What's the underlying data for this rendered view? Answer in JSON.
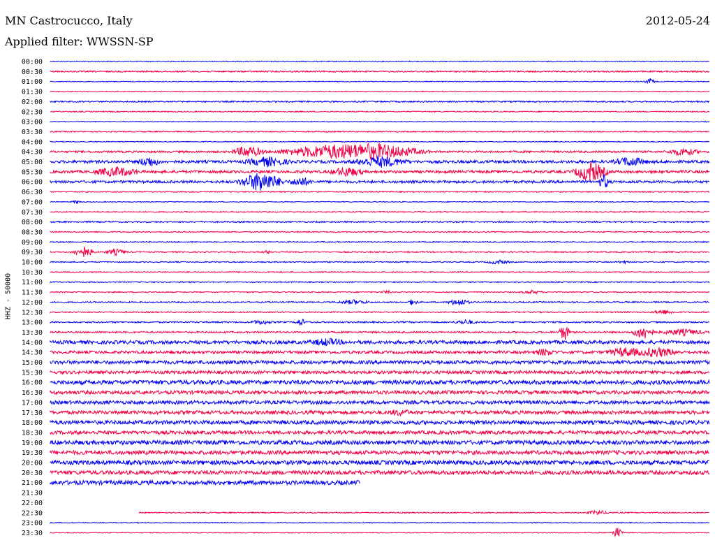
{
  "header": {
    "station": "MN Castrocucco, Italy",
    "date": "2012-05-24",
    "filter": "Applied filter: WWSSN-SP"
  },
  "chart_data": {
    "type": "line",
    "title": "MN Castrocucco, Italy",
    "ylabel": "HHZ - 50000",
    "trace_colors": [
      "#0000ee",
      "#ee0044"
    ],
    "rows": [
      {
        "label": "00:00",
        "coverage": 1.0,
        "noise": 0.6,
        "events": []
      },
      {
        "label": "00:30",
        "coverage": 1.0,
        "noise": 1.0,
        "events": []
      },
      {
        "label": "01:00",
        "coverage": 1.0,
        "noise": 0.6,
        "events": [
          {
            "at": 0.91,
            "amp": 4,
            "width": 0.01
          }
        ]
      },
      {
        "label": "01:30",
        "coverage": 1.0,
        "noise": 0.6,
        "events": []
      },
      {
        "label": "02:00",
        "coverage": 1.0,
        "noise": 1.0,
        "events": []
      },
      {
        "label": "02:30",
        "coverage": 1.0,
        "noise": 0.8,
        "events": []
      },
      {
        "label": "03:00",
        "coverage": 1.0,
        "noise": 0.6,
        "events": []
      },
      {
        "label": "03:30",
        "coverage": 1.0,
        "noise": 0.8,
        "events": []
      },
      {
        "label": "04:00",
        "coverage": 1.0,
        "noise": 0.6,
        "events": []
      },
      {
        "label": "04:30",
        "coverage": 1.0,
        "noise": 1.4,
        "events": [
          {
            "at": 0.3,
            "amp": 8,
            "width": 0.03
          },
          {
            "at": 0.42,
            "amp": 9,
            "width": 0.09
          },
          {
            "at": 0.5,
            "amp": 10,
            "width": 0.08
          },
          {
            "at": 0.96,
            "amp": 5,
            "width": 0.03
          }
        ]
      },
      {
        "label": "05:00",
        "coverage": 1.0,
        "noise": 2.0,
        "events": [
          {
            "at": 0.15,
            "amp": 7,
            "width": 0.02
          },
          {
            "at": 0.33,
            "amp": 6,
            "width": 0.04
          },
          {
            "at": 0.5,
            "amp": 7,
            "width": 0.05
          },
          {
            "at": 0.88,
            "amp": 6,
            "width": 0.03
          }
        ]
      },
      {
        "label": "05:30",
        "coverage": 1.0,
        "noise": 2.0,
        "events": [
          {
            "at": 0.1,
            "amp": 6,
            "width": 0.04
          },
          {
            "at": 0.45,
            "amp": 6,
            "width": 0.03
          },
          {
            "at": 0.82,
            "amp": 14,
            "width": 0.03
          }
        ]
      },
      {
        "label": "06:00",
        "coverage": 1.0,
        "noise": 1.8,
        "events": [
          {
            "at": 0.32,
            "amp": 14,
            "width": 0.04
          },
          {
            "at": 0.38,
            "amp": 6,
            "width": 0.02
          },
          {
            "at": 0.84,
            "amp": 10,
            "width": 0.01
          }
        ]
      },
      {
        "label": "06:30",
        "coverage": 1.0,
        "noise": 0.8,
        "events": []
      },
      {
        "label": "07:00",
        "coverage": 1.0,
        "noise": 0.6,
        "events": [
          {
            "at": 0.04,
            "amp": 2,
            "width": 0.01
          }
        ]
      },
      {
        "label": "07:30",
        "coverage": 1.0,
        "noise": 0.8,
        "events": []
      },
      {
        "label": "08:00",
        "coverage": 1.0,
        "noise": 1.0,
        "events": []
      },
      {
        "label": "08:30",
        "coverage": 1.0,
        "noise": 0.8,
        "events": []
      },
      {
        "label": "09:00",
        "coverage": 1.0,
        "noise": 0.8,
        "events": []
      },
      {
        "label": "09:30",
        "coverage": 1.0,
        "noise": 0.9,
        "events": [
          {
            "at": 0.05,
            "amp": 8,
            "width": 0.02
          },
          {
            "at": 0.1,
            "amp": 4,
            "width": 0.02
          },
          {
            "at": 0.33,
            "amp": 2,
            "width": 0.01
          }
        ]
      },
      {
        "label": "10:00",
        "coverage": 1.0,
        "noise": 0.8,
        "events": [
          {
            "at": 0.68,
            "amp": 3,
            "width": 0.02
          },
          {
            "at": 0.87,
            "amp": 2,
            "width": 0.01
          }
        ]
      },
      {
        "label": "10:30",
        "coverage": 1.0,
        "noise": 0.8,
        "events": []
      },
      {
        "label": "11:00",
        "coverage": 1.0,
        "noise": 0.8,
        "events": []
      },
      {
        "label": "11:30",
        "coverage": 1.0,
        "noise": 0.8,
        "events": [
          {
            "at": 0.51,
            "amp": 2,
            "width": 0.01
          },
          {
            "at": 0.73,
            "amp": 2,
            "width": 0.02
          }
        ]
      },
      {
        "label": "12:00",
        "coverage": 1.0,
        "noise": 0.9,
        "events": [
          {
            "at": 0.46,
            "amp": 3,
            "width": 0.03
          },
          {
            "at": 0.55,
            "amp": 4,
            "width": 0.01
          },
          {
            "at": 0.62,
            "amp": 5,
            "width": 0.02
          }
        ]
      },
      {
        "label": "12:30",
        "coverage": 1.0,
        "noise": 0.9,
        "events": [
          {
            "at": 0.93,
            "amp": 3,
            "width": 0.02
          }
        ]
      },
      {
        "label": "13:00",
        "coverage": 1.0,
        "noise": 1.0,
        "events": [
          {
            "at": 0.32,
            "amp": 3,
            "width": 0.02
          },
          {
            "at": 0.38,
            "amp": 5,
            "width": 0.01
          },
          {
            "at": 0.63,
            "amp": 3,
            "width": 0.02
          }
        ]
      },
      {
        "label": "13:30",
        "coverage": 1.0,
        "noise": 1.2,
        "events": [
          {
            "at": 0.78,
            "amp": 12,
            "width": 0.01
          },
          {
            "at": 0.9,
            "amp": 10,
            "width": 0.02
          },
          {
            "at": 0.96,
            "amp": 4,
            "width": 0.04
          }
        ]
      },
      {
        "label": "14:00",
        "coverage": 1.0,
        "noise": 2.5,
        "events": [
          {
            "at": 0.42,
            "amp": 4,
            "width": 0.03
          }
        ]
      },
      {
        "label": "14:30",
        "coverage": 1.0,
        "noise": 2.0,
        "events": [
          {
            "at": 0.75,
            "amp": 4,
            "width": 0.02
          },
          {
            "at": 0.87,
            "amp": 6,
            "width": 0.03
          },
          {
            "at": 0.92,
            "amp": 6,
            "width": 0.04
          }
        ]
      },
      {
        "label": "15:00",
        "coverage": 1.0,
        "noise": 2.5,
        "events": []
      },
      {
        "label": "15:30",
        "coverage": 1.0,
        "noise": 2.2,
        "events": []
      },
      {
        "label": "16:00",
        "coverage": 1.0,
        "noise": 3.0,
        "events": []
      },
      {
        "label": "16:30",
        "coverage": 1.0,
        "noise": 2.5,
        "events": []
      },
      {
        "label": "17:00",
        "coverage": 1.0,
        "noise": 2.5,
        "events": []
      },
      {
        "label": "17:30",
        "coverage": 1.0,
        "noise": 2.5,
        "events": [
          {
            "at": 0.53,
            "amp": 3,
            "width": 0.02
          }
        ]
      },
      {
        "label": "18:00",
        "coverage": 1.0,
        "noise": 2.8,
        "events": []
      },
      {
        "label": "18:30",
        "coverage": 1.0,
        "noise": 2.5,
        "events": []
      },
      {
        "label": "19:00",
        "coverage": 1.0,
        "noise": 3.0,
        "events": []
      },
      {
        "label": "19:30",
        "coverage": 1.0,
        "noise": 2.8,
        "events": []
      },
      {
        "label": "20:00",
        "coverage": 1.0,
        "noise": 3.0,
        "events": []
      },
      {
        "label": "20:30",
        "coverage": 1.0,
        "noise": 2.8,
        "events": []
      },
      {
        "label": "21:00",
        "coverage": 0.47,
        "noise": 3.0,
        "events": []
      },
      {
        "label": "21:30",
        "coverage": 0.0,
        "noise": 0,
        "events": []
      },
      {
        "label": "22:00",
        "coverage": 0.0,
        "noise": 0,
        "events": []
      },
      {
        "label": "22:30",
        "start": 0.135,
        "coverage": 1.0,
        "noise": 0.8,
        "events": [
          {
            "at": 0.83,
            "amp": 3,
            "width": 0.02
          }
        ]
      },
      {
        "label": "23:00",
        "coverage": 1.0,
        "noise": 0.6,
        "events": []
      },
      {
        "label": "23:30",
        "coverage": 1.0,
        "noise": 0.6,
        "events": [
          {
            "at": 0.86,
            "amp": 8,
            "width": 0.01
          }
        ]
      }
    ]
  }
}
